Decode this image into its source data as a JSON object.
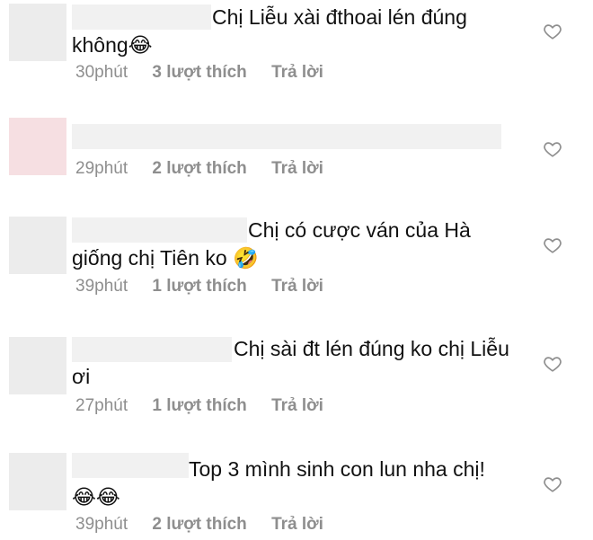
{
  "comments": [
    {
      "text": "Chị Liễu xài đthoai lén đúng không",
      "emoji": "😂",
      "time": "30phút",
      "likes": "3 lượt thích",
      "reply": "Trả lời"
    },
    {
      "text": "",
      "emoji": "",
      "time": "29phút",
      "likes": "2 lượt thích",
      "reply": "Trả lời"
    },
    {
      "text": "Chị có cược ván của Hà giống chị Tiên ko",
      "emoji": "🤣",
      "time": "39phút",
      "likes": "1 lượt thích",
      "reply": "Trả lời"
    },
    {
      "text": "Chị sài đt lén đúng ko chị Liễu ơi",
      "emoji": "",
      "time": "27phút",
      "likes": "1 lượt thích",
      "reply": "Trả lời"
    },
    {
      "text": "Top 3 mình sinh con lun nha chị!",
      "emoji": "😂😂",
      "time": "39phút",
      "likes": "2 lượt thích",
      "reply": "Trả lời"
    }
  ],
  "icons": {
    "like": "heart-outline-icon"
  },
  "colors": {
    "meta": "#8e8e8e",
    "text": "#111111",
    "blur": "#f1f1f1"
  }
}
